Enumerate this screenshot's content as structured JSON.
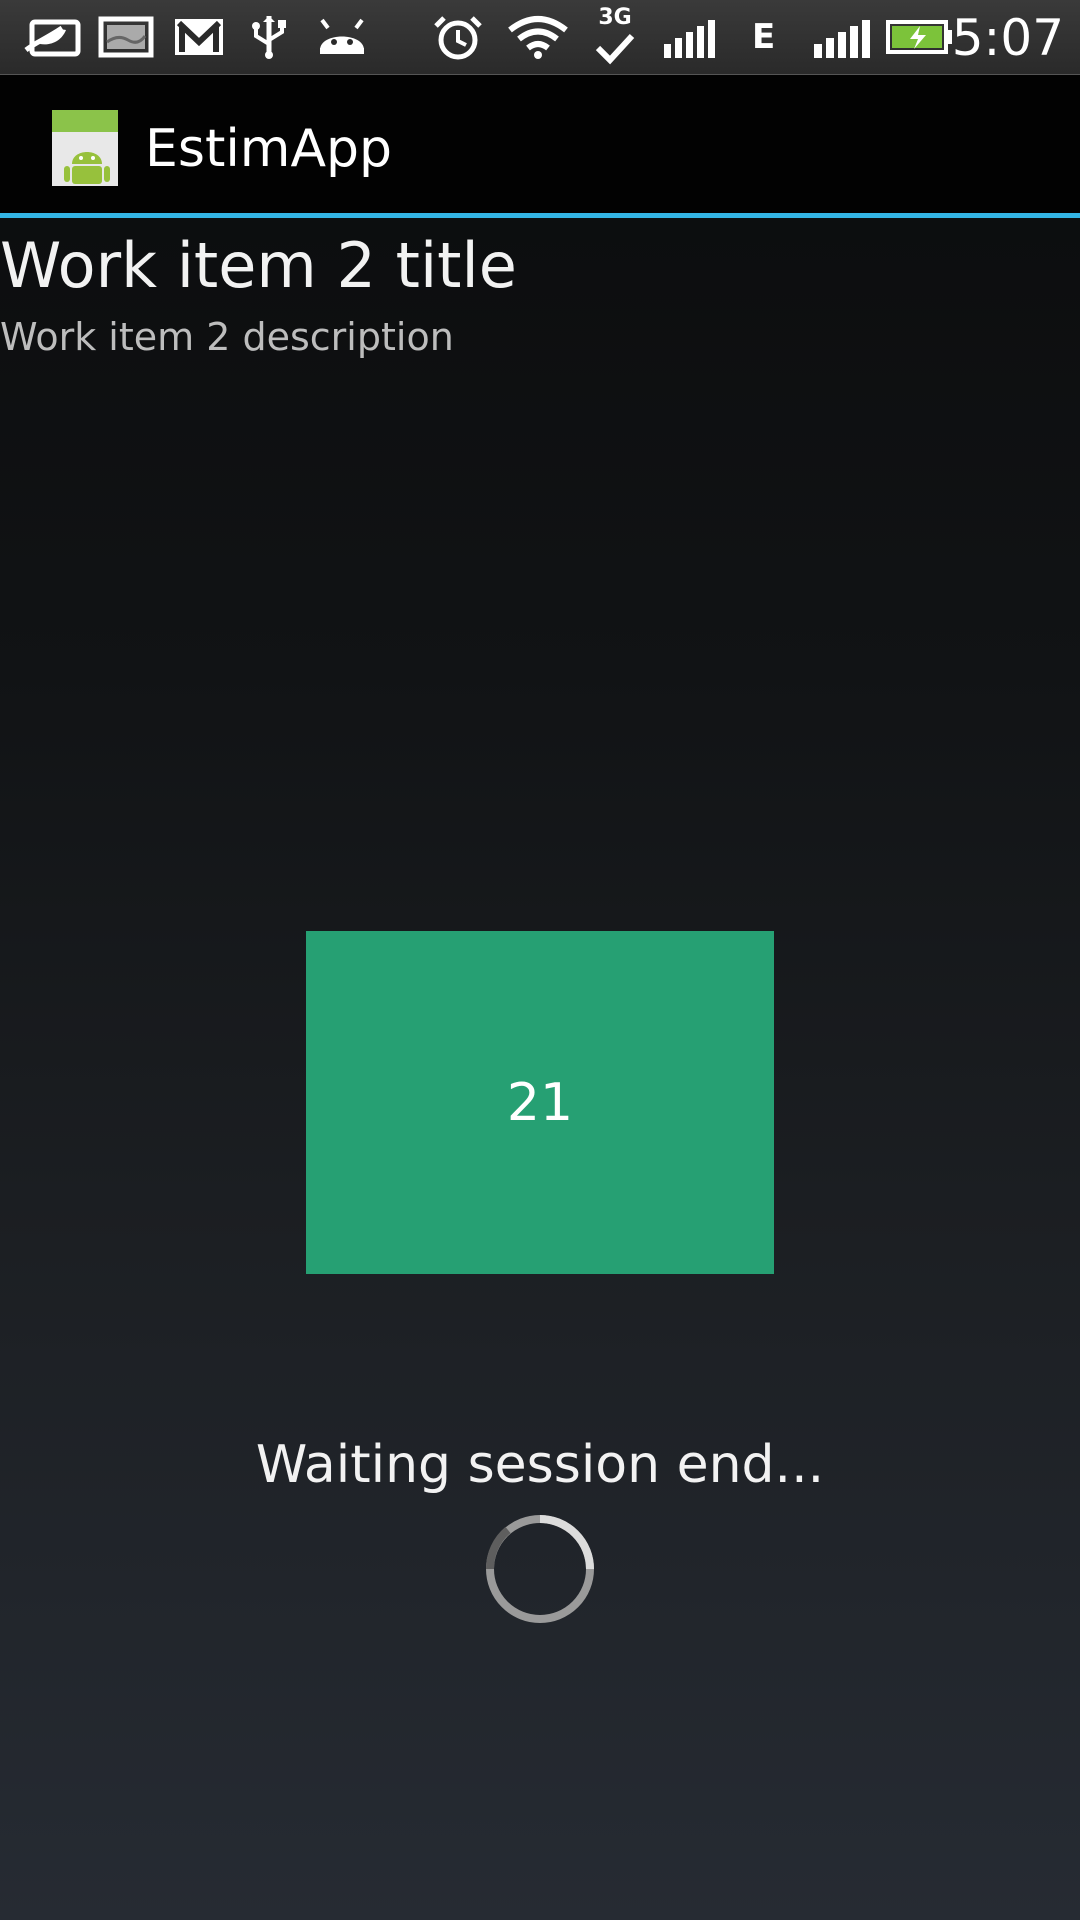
{
  "status_bar": {
    "time": "5:07",
    "network_3g": "3G",
    "network_e": "E",
    "icons": [
      "leaf-icon",
      "image-icon",
      "gmail-icon",
      "usb-icon",
      "android-debug-icon",
      "alarm-icon",
      "wifi-icon",
      "3g-sync-icon",
      "signal-icon",
      "edge-icon",
      "signal-icon",
      "battery-charging-icon"
    ]
  },
  "action_bar": {
    "app_title": "EstimApp",
    "app_icon": "android-app-icon",
    "divider_color": "#33b5e5"
  },
  "work_item": {
    "title": "Work item 2 title",
    "description": "Work item 2 description"
  },
  "estimate": {
    "value": "21",
    "color": "#26a073"
  },
  "session": {
    "status_text": "Waiting session end..."
  }
}
